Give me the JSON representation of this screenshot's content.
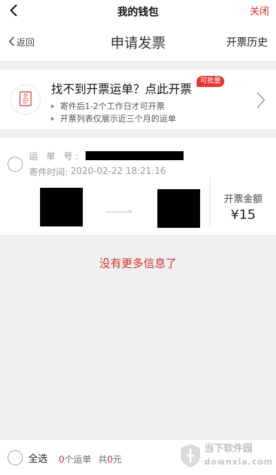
{
  "status_bar": {
    "title": "我的钱包",
    "close_label": "关闭"
  },
  "nav": {
    "back_label": "返回",
    "page_title": "申请发票",
    "history_label": "开票历史"
  },
  "banner": {
    "title": "找不到开票运单？点此开票",
    "badge": "可批量",
    "tips": [
      "寄件后1-2个工作日才可开票",
      "开票列表仅展示近三个月的运单"
    ],
    "icon": "invoice-scroll-icon"
  },
  "waybill": {
    "number_label": "运 单 号:",
    "time_label": "寄件时间:",
    "time_value": "2020-02-22 18:21:16",
    "amount_label": "开票金额",
    "amount_value": "¥15"
  },
  "list_end_text": "没有更多信息了",
  "footer": {
    "select_all_label": "全选",
    "count": "0",
    "count_unit": "个运单",
    "total_prefix": "共",
    "total": "0",
    "total_unit": "元"
  },
  "watermark": {
    "line1": "当下软件园",
    "line2": "downxia.com"
  },
  "colors": {
    "accent_red": "#e02828",
    "badge_red": "#e8332f",
    "background": "#f0f0f0"
  }
}
